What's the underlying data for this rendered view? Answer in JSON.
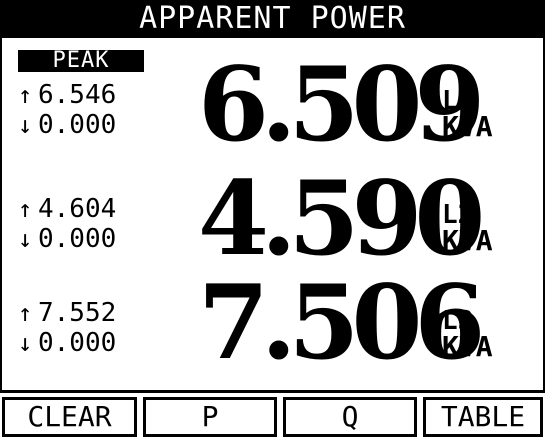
{
  "title": "APPARENT POWER",
  "peak_label": "PEAK",
  "arrows": {
    "up": "↑",
    "down": "↓"
  },
  "phases": [
    {
      "max": "6.546",
      "min": "0.000",
      "value": "6.509",
      "phase": "L1",
      "unit": "KVA"
    },
    {
      "max": "4.604",
      "min": "0.000",
      "value": "4.590",
      "phase": "L2",
      "unit": "KVA"
    },
    {
      "max": "7.552",
      "min": "0.000",
      "value": "7.506",
      "phase": "L3",
      "unit": "KVA"
    }
  ],
  "softkeys": [
    "CLEAR",
    "P",
    "Q",
    "TABLE"
  ],
  "colors": {
    "background": "#ffffff",
    "foreground": "#000000"
  }
}
